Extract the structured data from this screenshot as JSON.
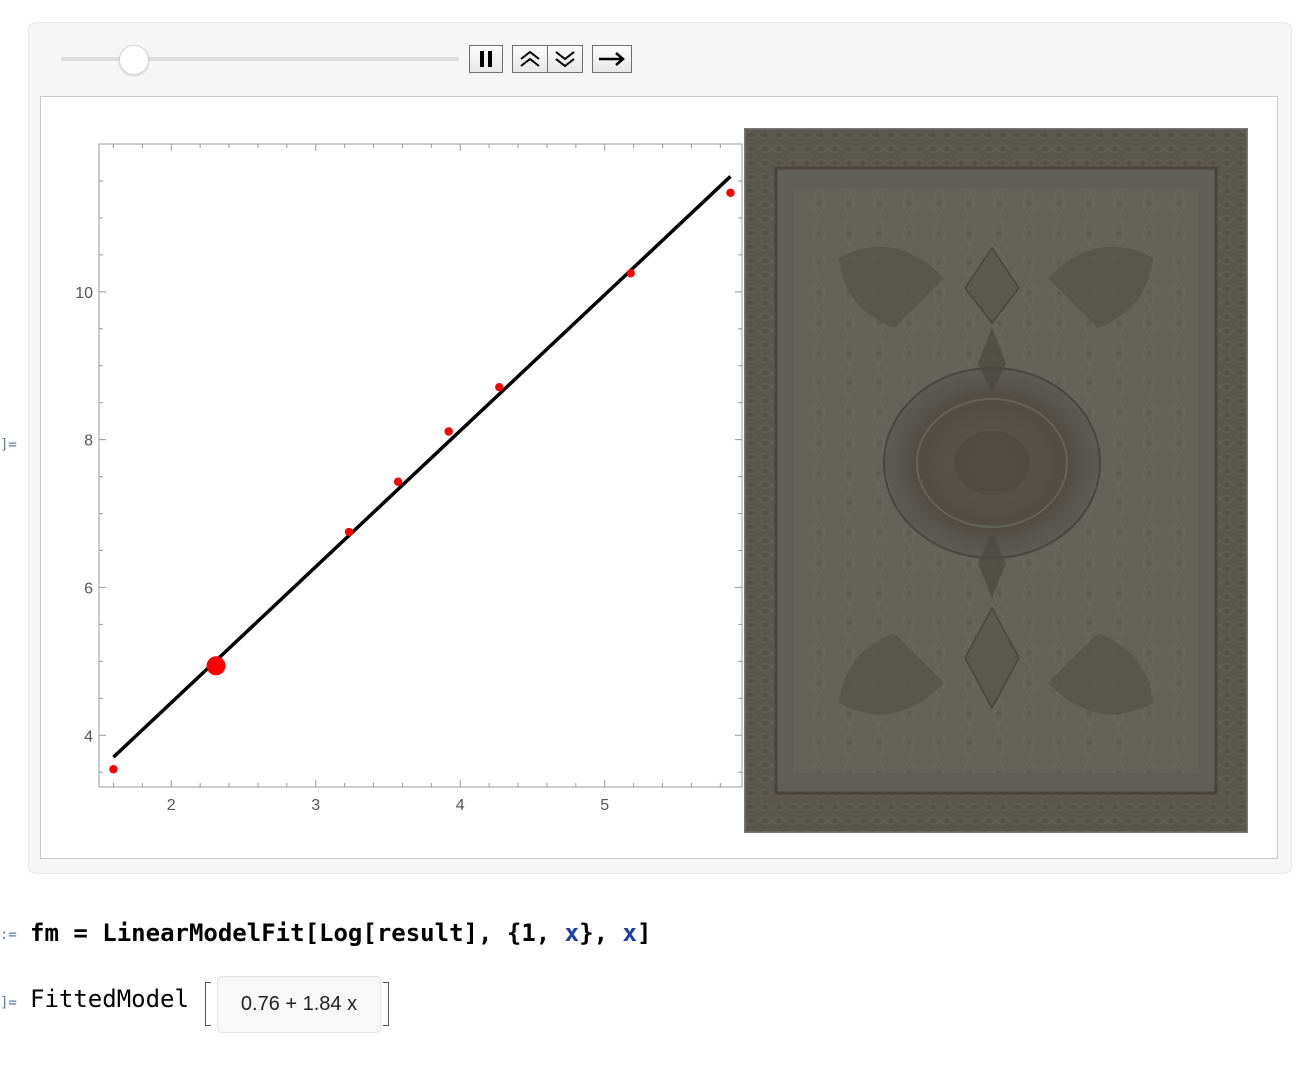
{
  "output_marker": "]=",
  "input_marker": ":=",
  "controls": {
    "slider_value": 0.18,
    "buttons": [
      "pause-icon",
      "faster-icon",
      "slower-icon",
      "step-forward-icon"
    ]
  },
  "chart_data": {
    "type": "scatter",
    "title": "",
    "xlabel": "",
    "ylabel": "",
    "xlim": [
      1.5,
      5.95
    ],
    "ylim": [
      3.3,
      12.0
    ],
    "x_ticks": [
      "2",
      "3",
      "4",
      "5"
    ],
    "y_ticks": [
      "4",
      "6",
      "8",
      "10"
    ],
    "grid": false,
    "points": [
      {
        "x": 1.6,
        "y": 3.54
      },
      {
        "x": 3.23,
        "y": 6.75
      },
      {
        "x": 3.57,
        "y": 7.43
      },
      {
        "x": 3.92,
        "y": 8.11
      },
      {
        "x": 4.27,
        "y": 8.71
      },
      {
        "x": 5.18,
        "y": 10.25
      },
      {
        "x": 5.87,
        "y": 11.34
      }
    ],
    "highlight_point": {
      "x": 2.31,
      "y": 4.94
    },
    "fit_line": {
      "intercept": 0.76,
      "slope": 1.84,
      "x_range": [
        1.6,
        5.87
      ]
    },
    "colors": {
      "points": "#ff0000",
      "line": "#000000"
    }
  },
  "code": {
    "var": "fm",
    "eq": " = ",
    "func": "LinearModelFit",
    "open": "[",
    "inner_func": "Log",
    "inner_arg": "[result]",
    "sep": ", ",
    "list_open": "{1, ",
    "sym1": "x",
    "list_close": "}",
    "sep2": ", ",
    "sym2": "x",
    "close": "]"
  },
  "output": {
    "head": "FittedModel",
    "formula": "0.76 + 1.84 x"
  }
}
